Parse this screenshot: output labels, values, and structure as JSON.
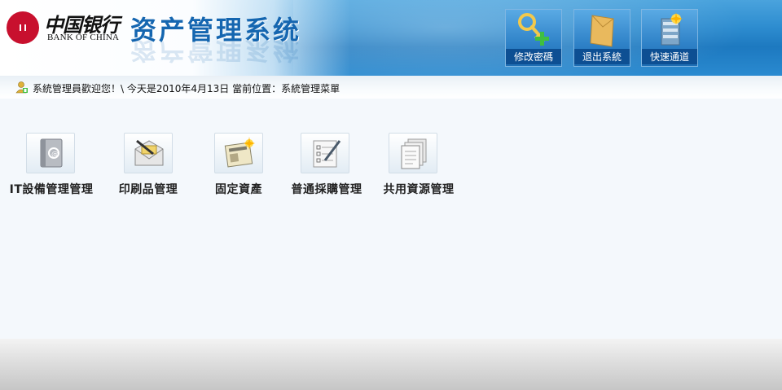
{
  "header": {
    "bank_name_cn": "中国银行",
    "bank_name_en": "BANK OF CHINA",
    "system_title": "资产管理系统",
    "quick_buttons": [
      {
        "label": "修改密碼",
        "icon": "key-plus-icon"
      },
      {
        "label": "退出系統",
        "icon": "envelope-exit-icon"
      },
      {
        "label": "快速通道",
        "icon": "server-shortcut-icon"
      }
    ]
  },
  "status": {
    "text": "系統管理員歡迎您！\\ 今天是2010年4月13日  當前位置：系統管理菜單",
    "icon": "user-icon"
  },
  "menu": [
    {
      "label": "IT設備管理管理",
      "icon": "address-book-icon"
    },
    {
      "label": "印刷品管理",
      "icon": "mail-pen-icon"
    },
    {
      "label": "固定資產",
      "icon": "newspaper-icon"
    },
    {
      "label": "普通採購管理",
      "icon": "form-pen-icon"
    },
    {
      "label": "共用資源管理",
      "icon": "documents-icon"
    }
  ],
  "colors": {
    "header_blue": "#1d79c0",
    "title_blue": "#1566b0",
    "boc_red": "#c8102e"
  }
}
